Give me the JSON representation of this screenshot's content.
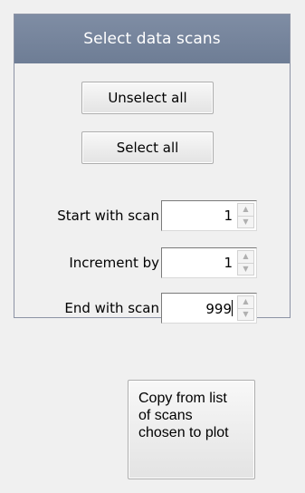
{
  "panel": {
    "title": "Select data scans",
    "unselect_all_label": "Unselect all",
    "select_all_label": "Select all",
    "start": {
      "label": "Start with scan",
      "value": "1"
    },
    "increment": {
      "label": "Increment by",
      "value": "1"
    },
    "end": {
      "label": "End with scan",
      "value": "999"
    }
  },
  "copy_button_label": "Copy from list\nof scans\nchosen to plot",
  "colors": {
    "header_bg": "#7a889f",
    "header_text": "#ffffff",
    "panel_border": "#8c93a5",
    "window_bg": "#f0f0f0"
  },
  "icons": {
    "spin_up": "triangle-up-icon",
    "spin_down": "triangle-down-icon"
  }
}
